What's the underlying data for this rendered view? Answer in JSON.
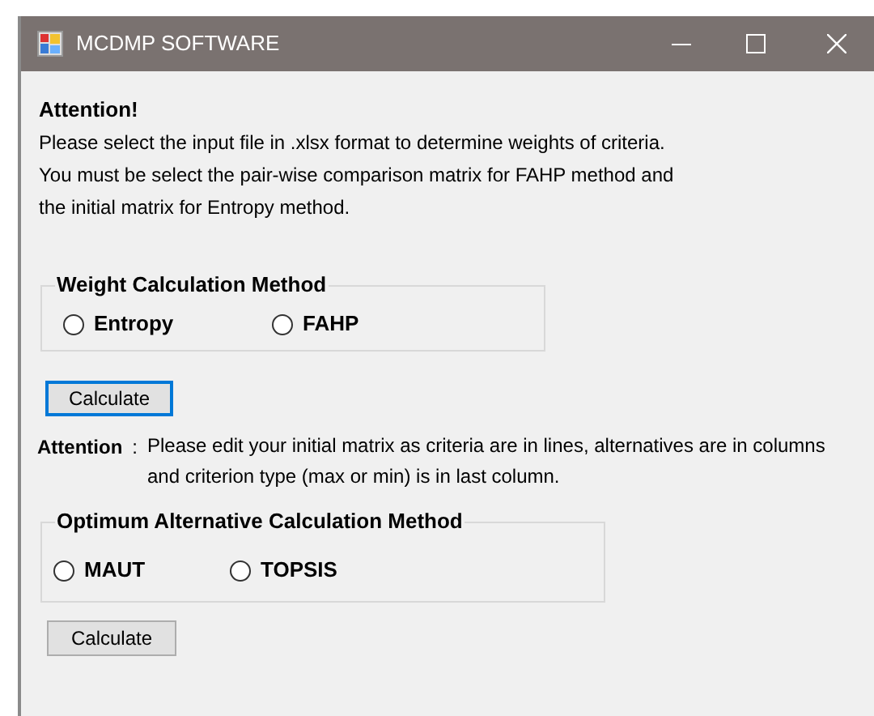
{
  "window": {
    "title": "MCDMP SOFTWARE"
  },
  "attention": {
    "heading": "Attention!",
    "lines": [
      "Please select the input file in .xlsx format to determine weights of criteria.",
      "You must be select the pair-wise comparison matrix for FAHP method and",
      "the initial matrix for Entropy method."
    ]
  },
  "weight_group": {
    "legend": "Weight Calculation Method",
    "options": [
      {
        "label": "Entropy",
        "selected": false
      },
      {
        "label": "FAHP",
        "selected": false
      }
    ]
  },
  "weight_button": {
    "label": "Calculate",
    "focused": true
  },
  "note": {
    "label": "Attention",
    "separator": ":",
    "lines": [
      "Please edit your initial matrix as criteria are in lines, alternatives are in columns",
      "and criterion type (max or min) is in last column."
    ]
  },
  "optimum_group": {
    "legend": "Optimum Alternative Calculation Method",
    "options": [
      {
        "label": "MAUT",
        "selected": false
      },
      {
        "label": "TOPSIS",
        "selected": false
      }
    ]
  },
  "optimum_button": {
    "label": "Calculate",
    "focused": false
  }
}
